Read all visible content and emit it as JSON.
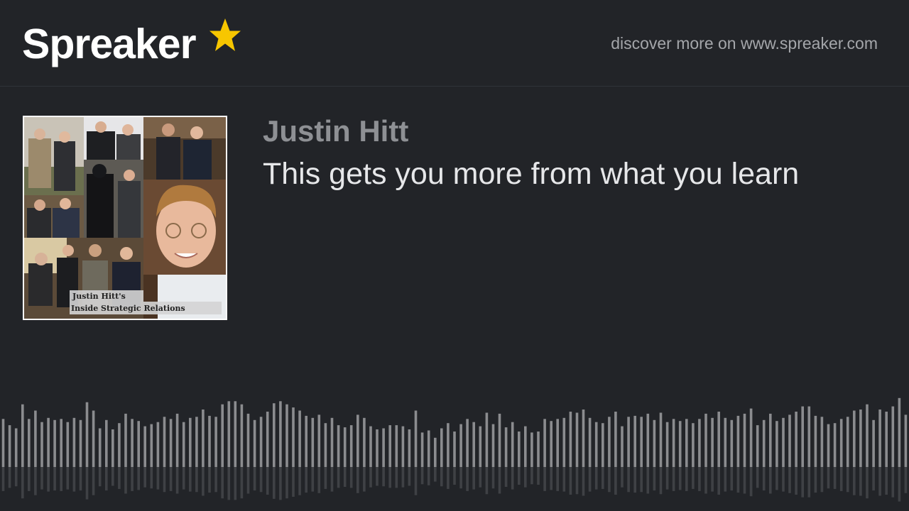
{
  "header": {
    "logo_text": "Spreaker",
    "logo_icon": "star-icon",
    "star_color": "#f7c600",
    "discover_text": "discover more on www.spreaker.com"
  },
  "episode": {
    "author": "Justin Hitt",
    "title": "This gets you more from what you learn",
    "cover_caption_line1": "Justin Hitt's",
    "cover_caption_line2": "Inside Strategic Relations"
  },
  "waveform": {
    "bar_color": "#8b8c8f",
    "reflection_color": "#3f4145",
    "levels": [
      0.46,
      0.4,
      0.37,
      0.6,
      0.46,
      0.54,
      0.43,
      0.47,
      0.45,
      0.46,
      0.43,
      0.47,
      0.45,
      0.62,
      0.54,
      0.37,
      0.45,
      0.36,
      0.42,
      0.51,
      0.46,
      0.44,
      0.39,
      0.41,
      0.43,
      0.48,
      0.46,
      0.51,
      0.43,
      0.47,
      0.48,
      0.55,
      0.49,
      0.48,
      0.6,
      0.63,
      0.63,
      0.6,
      0.51,
      0.45,
      0.48,
      0.53,
      0.61,
      0.63,
      0.6,
      0.57,
      0.54,
      0.49,
      0.47,
      0.5,
      0.42,
      0.47,
      0.4,
      0.38,
      0.4,
      0.5,
      0.47,
      0.39,
      0.36,
      0.37,
      0.4,
      0.4,
      0.39,
      0.36,
      0.54,
      0.33,
      0.35,
      0.28,
      0.37,
      0.42,
      0.34,
      0.41,
      0.46,
      0.43,
      0.39,
      0.52,
      0.41,
      0.51,
      0.38,
      0.43,
      0.34,
      0.39,
      0.33,
      0.34,
      0.46,
      0.44,
      0.46,
      0.47,
      0.53,
      0.52,
      0.55,
      0.47,
      0.43,
      0.42,
      0.48,
      0.53,
      0.39,
      0.48,
      0.49,
      0.48,
      0.51,
      0.45,
      0.52,
      0.43,
      0.46,
      0.44,
      0.46,
      0.42,
      0.46,
      0.51,
      0.47,
      0.53,
      0.47,
      0.45,
      0.49,
      0.51,
      0.56,
      0.4,
      0.45,
      0.51,
      0.44,
      0.47,
      0.5,
      0.53,
      0.58,
      0.58,
      0.49,
      0.48,
      0.41,
      0.42,
      0.46,
      0.48,
      0.54,
      0.55,
      0.6,
      0.45,
      0.55,
      0.53,
      0.58,
      0.66,
      0.5
    ]
  }
}
